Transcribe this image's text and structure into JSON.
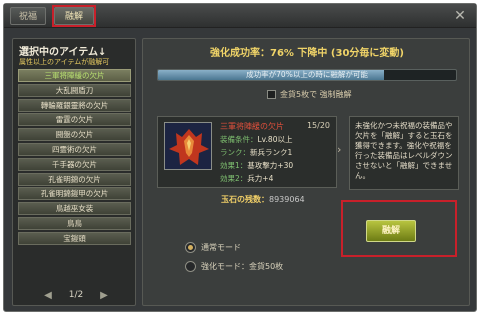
{
  "tabs": [
    {
      "label": "祝福"
    },
    {
      "label": "融解"
    }
  ],
  "left": {
    "title": "選択中のアイテム↓",
    "subtitle": "属性以上のアイテムが融解可",
    "items": [
      {
        "label": "三軍将陣緩の欠片"
      },
      {
        "label": "大乱闘盾刀"
      },
      {
        "label": "轉輪羅銀靈將の欠片"
      },
      {
        "label": "雷霆の欠片"
      },
      {
        "label": "闘盤の欠片"
      },
      {
        "label": "四霊術の欠片"
      },
      {
        "label": "千手器の欠片"
      },
      {
        "label": "孔雀明錦の欠片"
      },
      {
        "label": "孔雀明錦鎧甲の欠片"
      },
      {
        "label": "鳥越巫女装"
      },
      {
        "label": "鳥鳥"
      },
      {
        "label": "宝鎧頭"
      }
    ],
    "page": "1/2"
  },
  "right": {
    "rate_text": "強化成功率：76% 下降中 (30分毎に変動)",
    "progress_text": "成功率が70%以上の時に融解が可能",
    "progress": 0.76,
    "gold_check_label": "金貨5枚で 強制融解",
    "item": {
      "name": "三軍将陣緩の欠片",
      "count": "15/20",
      "stats": [
        {
          "key": "装備条件：",
          "value": "Lv.80以上"
        },
        {
          "key": "ランク：",
          "value": "新兵ランク1"
        },
        {
          "key": "効果1：",
          "value": "基攻撃力+30"
        },
        {
          "key": "効果2：",
          "value": "兵力+4"
        }
      ]
    },
    "description": "未強化かつ未祝福の装備品や欠片を「融解」すると玉石を獲得できます。強化や祝福を行った装備品はレベルダウンさせないと「融解」できません。",
    "gem_label": "玉石の残数：",
    "gem_value": "8939064",
    "modes": [
      {
        "label": "通常モード",
        "selected": true
      },
      {
        "label": "強化モード：金貨50枚",
        "selected": false
      }
    ],
    "fuse_button": "融解"
  },
  "colors": {
    "accent": "#f0d468",
    "highlight": "#c8202a",
    "button": "#8a9a28"
  }
}
